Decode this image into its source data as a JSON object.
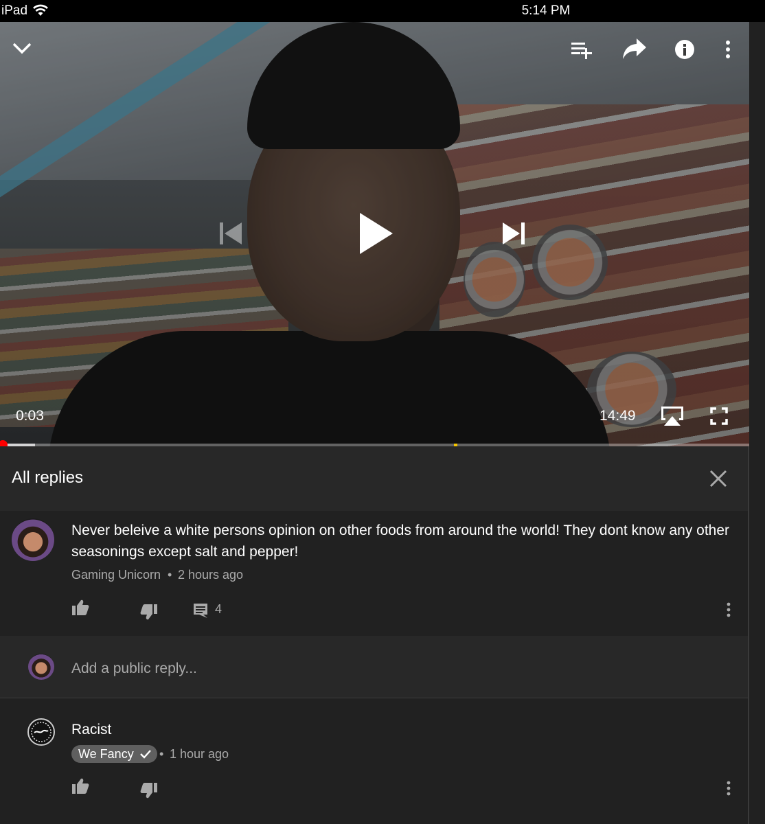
{
  "status_bar": {
    "device": "iPad",
    "time": "5:14 PM"
  },
  "player": {
    "current_time": "0:03",
    "duration": "14:49",
    "played_fraction": 0.0035,
    "buffered_fraction": 0.047,
    "ad_marker_fraction": 0.606,
    "icons": [
      "chevron-down-icon",
      "add-to-playlist-icon",
      "share-icon",
      "info-icon",
      "more-vert-icon",
      "previous-icon",
      "play-icon",
      "next-icon",
      "airplay-icon",
      "fullscreen-icon"
    ]
  },
  "panel": {
    "title": "All replies"
  },
  "comment": {
    "text": "Never beleive a white persons opinion on other foods from around the world! They dont know any other seasonings except salt and pepper!",
    "author": "Gaming Unicorn",
    "separator": "•",
    "time": "2 hours ago",
    "reply_count": "4"
  },
  "reply_box": {
    "placeholder": "Add a public reply..."
  },
  "replies": [
    {
      "text": "Racist",
      "author": "We Fancy",
      "separator": "•",
      "time": "1 hour ago"
    }
  ],
  "colors": {
    "accent": "#ff0000",
    "background": "#212121",
    "header": "#282828",
    "secondary_text": "#aaaaaa",
    "badge": "#5f5f5f"
  }
}
